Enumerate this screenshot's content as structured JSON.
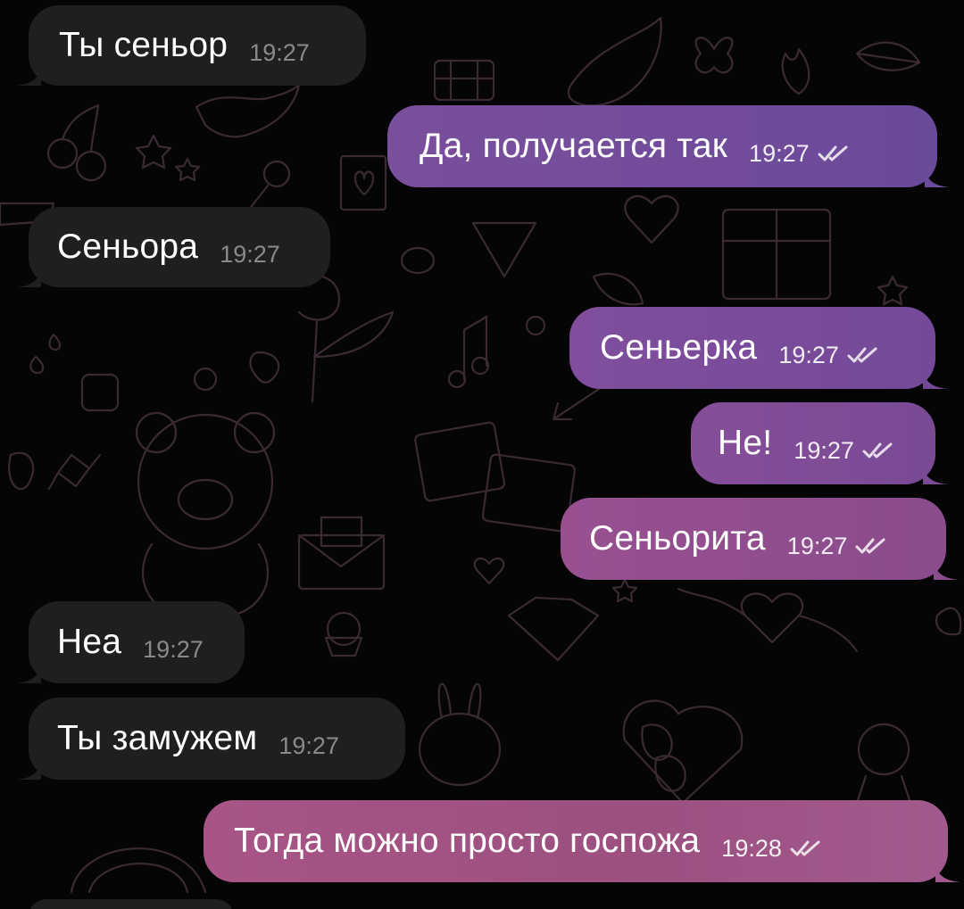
{
  "messages": [
    {
      "dir": "in",
      "text": "Ты сеньор",
      "time": "19:27"
    },
    {
      "dir": "out",
      "text": "Да, получается так",
      "time": "19:27",
      "read": true,
      "color": "#6a4a9a"
    },
    {
      "dir": "in",
      "text": "Сеньора",
      "time": "19:27"
    },
    {
      "dir": "out",
      "text": "Сеньерка",
      "time": "19:27",
      "read": true,
      "color": "#764a9a"
    },
    {
      "dir": "out",
      "text": "Не!",
      "time": "19:27",
      "read": true,
      "color": "#7c4a94"
    },
    {
      "dir": "out",
      "text": "Сеньорита",
      "time": "19:27",
      "read": true,
      "color": "#8e4c8c"
    },
    {
      "dir": "in",
      "text": "Неа",
      "time": "19:27"
    },
    {
      "dir": "in",
      "text": "Ты замужем",
      "time": "19:27"
    },
    {
      "dir": "out",
      "text": "Тогда можно просто госпожа",
      "time": "19:28",
      "read": true,
      "color": "#9a4d80"
    }
  ],
  "colors": {
    "background": "#050505",
    "incoming_bubble": "#1f1f1f",
    "outgoing_gradient_top": "#7a4f9c",
    "outgoing_gradient_bottom": "#a25480",
    "pattern_stroke": "#3a2a33"
  },
  "icons": {
    "read_receipt": "double-check-icon"
  }
}
